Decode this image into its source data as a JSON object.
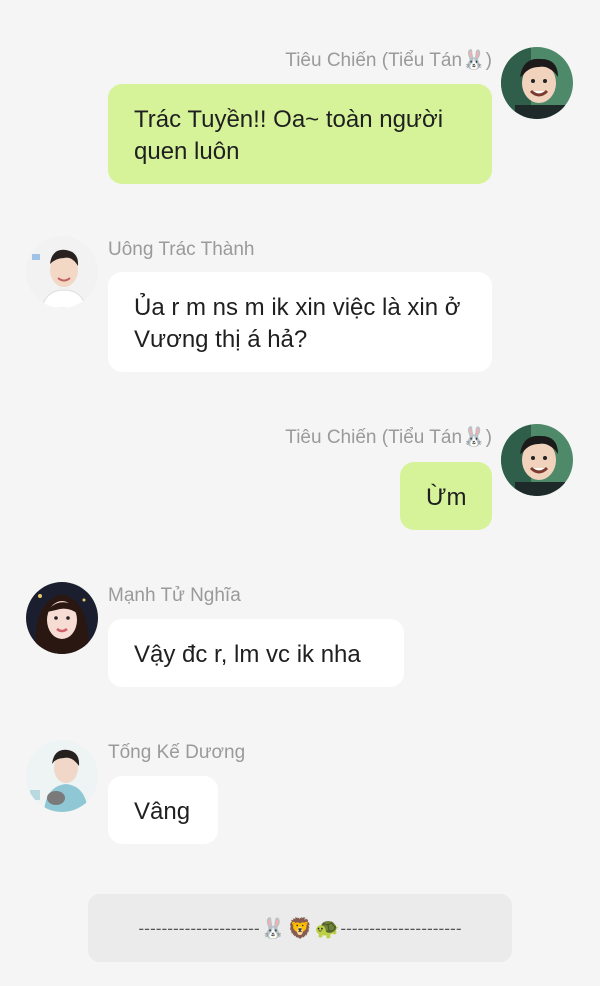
{
  "messages": [
    {
      "sender": "Tiêu Chiến (Tiểu Tán🐰)",
      "text": "Trác Tuyền!! Oa~ toàn người quen luôn",
      "direction": "outgoing"
    },
    {
      "sender": "Uông Trác Thành",
      "text": "Ủa r m ns m ik xin việc là xin ở Vương thị á hả?",
      "direction": "incoming"
    },
    {
      "sender": "Tiêu Chiến (Tiểu Tán🐰)",
      "text": "Ừm",
      "direction": "outgoing"
    },
    {
      "sender": "Mạnh Tử Nghĩa",
      "text": "Vậy đc r, lm vc ik nha",
      "direction": "incoming"
    },
    {
      "sender": "Tống Kế Dương",
      "text": "Vâng",
      "direction": "incoming"
    }
  ],
  "divider": {
    "left": "---------------------",
    "emojis": [
      "🐰",
      "🦁",
      "🐢"
    ],
    "right": "---------------------"
  },
  "colors": {
    "background": "#f5f5f5",
    "outgoing_bubble": "#d6f39a",
    "incoming_bubble": "#ffffff",
    "sender_name": "#9a9a9a"
  }
}
